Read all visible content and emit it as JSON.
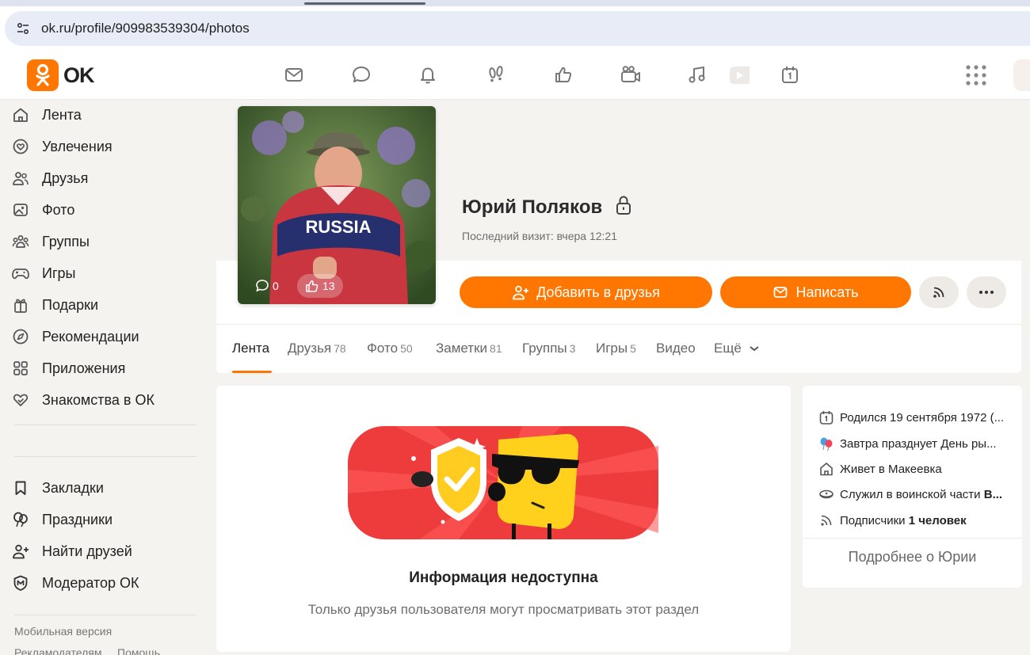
{
  "browser": {
    "url": "ok.ru/profile/909983539304/photos"
  },
  "brand": {
    "name": "OK",
    "accent": "#ff7700"
  },
  "topbar": {
    "icons": [
      "mail-icon",
      "chat-bubble-icon",
      "bell-icon",
      "guests-footprints-icon",
      "like-icon",
      "camera-icon",
      "music-icon",
      "video-play-icon",
      "calendar-icon",
      "apps-grid-icon"
    ]
  },
  "sidebar": {
    "items": [
      {
        "label": "Лента",
        "icon": "home-icon"
      },
      {
        "label": "Увлечения",
        "icon": "heart-icon"
      },
      {
        "label": "Друзья",
        "icon": "friends-icon"
      },
      {
        "label": "Фото",
        "icon": "photo-icon"
      },
      {
        "label": "Группы",
        "icon": "groups-icon"
      },
      {
        "label": "Игры",
        "icon": "gamepad-icon"
      },
      {
        "label": "Подарки",
        "icon": "gift-icon"
      },
      {
        "label": "Рекомендации",
        "icon": "compass-icon"
      },
      {
        "label": "Приложения",
        "icon": "apps-icon"
      },
      {
        "label": "Знакомства в ОК",
        "icon": "dating-icon"
      }
    ],
    "secondary": [
      {
        "label": "Закладки",
        "icon": "bookmark-icon"
      },
      {
        "label": "Праздники",
        "icon": "balloons-icon"
      },
      {
        "label": "Найти друзей",
        "icon": "add-friend-icon"
      },
      {
        "label": "Модератор ОК",
        "icon": "moderator-icon"
      }
    ],
    "footer": {
      "mobile": "Мобильная версия",
      "advertisers": "Рекламодателям",
      "help": "Помощь"
    }
  },
  "profile": {
    "name": "Юрий Поляков",
    "last_visit": "Последний визит: вчера 12:21",
    "photo_comments": "0",
    "photo_likes": "13",
    "add_friend": "Добавить в друзья",
    "write": "Написать"
  },
  "tabs": [
    {
      "label": "Лента",
      "count": ""
    },
    {
      "label": "Друзья",
      "count": "78"
    },
    {
      "label": "Фото",
      "count": "50"
    },
    {
      "label": "Заметки",
      "count": "81"
    },
    {
      "label": "Группы",
      "count": "3"
    },
    {
      "label": "Игры",
      "count": "5"
    },
    {
      "label": "Видео",
      "count": ""
    },
    {
      "label": "Ещё",
      "count": ""
    }
  ],
  "locked": {
    "title": "Информация недоступна",
    "subtitle": "Только друзья пользователя могут просматривать этот раздел"
  },
  "about": {
    "born": "Родился 19 сентября 1972 (...",
    "holiday": "Завтра празднует День ры...",
    "lives": "Живет в Макеевка",
    "served_prefix": "Служил в воинской части ",
    "served_bold": "В...",
    "subs_prefix": "Подписчики ",
    "subs_bold": "1 человек",
    "more": "Подробнее о Юрии"
  }
}
